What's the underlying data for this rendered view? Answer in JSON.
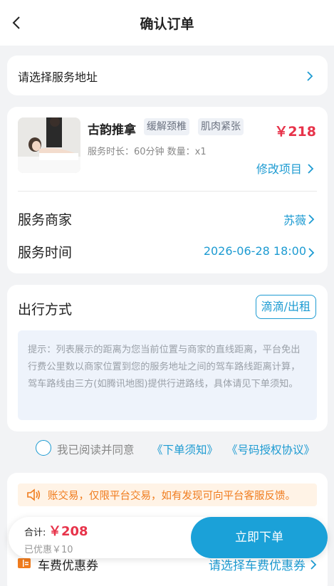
{
  "header": {
    "title": "确认订单"
  },
  "address": {
    "placeholder_text": "请选择服务地址"
  },
  "order": {
    "service_name": "古韵推拿",
    "tags": [
      "缓解颈椎",
      "肌肉紧张"
    ],
    "price": "￥218",
    "meta": "服务时长：60分钟  数量：x1",
    "edit_label": "修改项目",
    "merchant_label": "服务商家",
    "merchant_value": "苏薇",
    "time_label": "服务时间",
    "time_value": "2026-06-28 18:00"
  },
  "travel": {
    "title": "出行方式",
    "mode": "滴滴/出租",
    "tip": "提示：列表展示的距离为您当前位置与商家的直线距离，平台免出行费公里数以商家位置到您的服务地址之间的驾车路线距离计算，驾车路线由三方(如腾讯地图)提供行进路线，具体请见下单须知。"
  },
  "agreement": {
    "text": "我已阅读并同意",
    "link1": "《下单须知》",
    "link2": "《号码授权协议》"
  },
  "notice": {
    "text": "账交易，仅限平台交易，如有发现可向平台客服反馈。"
  },
  "coupon": {
    "label": "车费优惠券",
    "value": "请选择车费优惠券"
  },
  "footer": {
    "total_label": "合计:",
    "total_value": "￥208",
    "discount": "已优惠￥10",
    "submit_label": "立即下单"
  },
  "colors": {
    "accent": "#1d9bd2",
    "price": "#e7334a",
    "warning": "#f07c1e"
  },
  "icons": [
    "back-arrow-icon",
    "chevron-right-icon",
    "speaker-icon",
    "coupon-icon"
  ]
}
